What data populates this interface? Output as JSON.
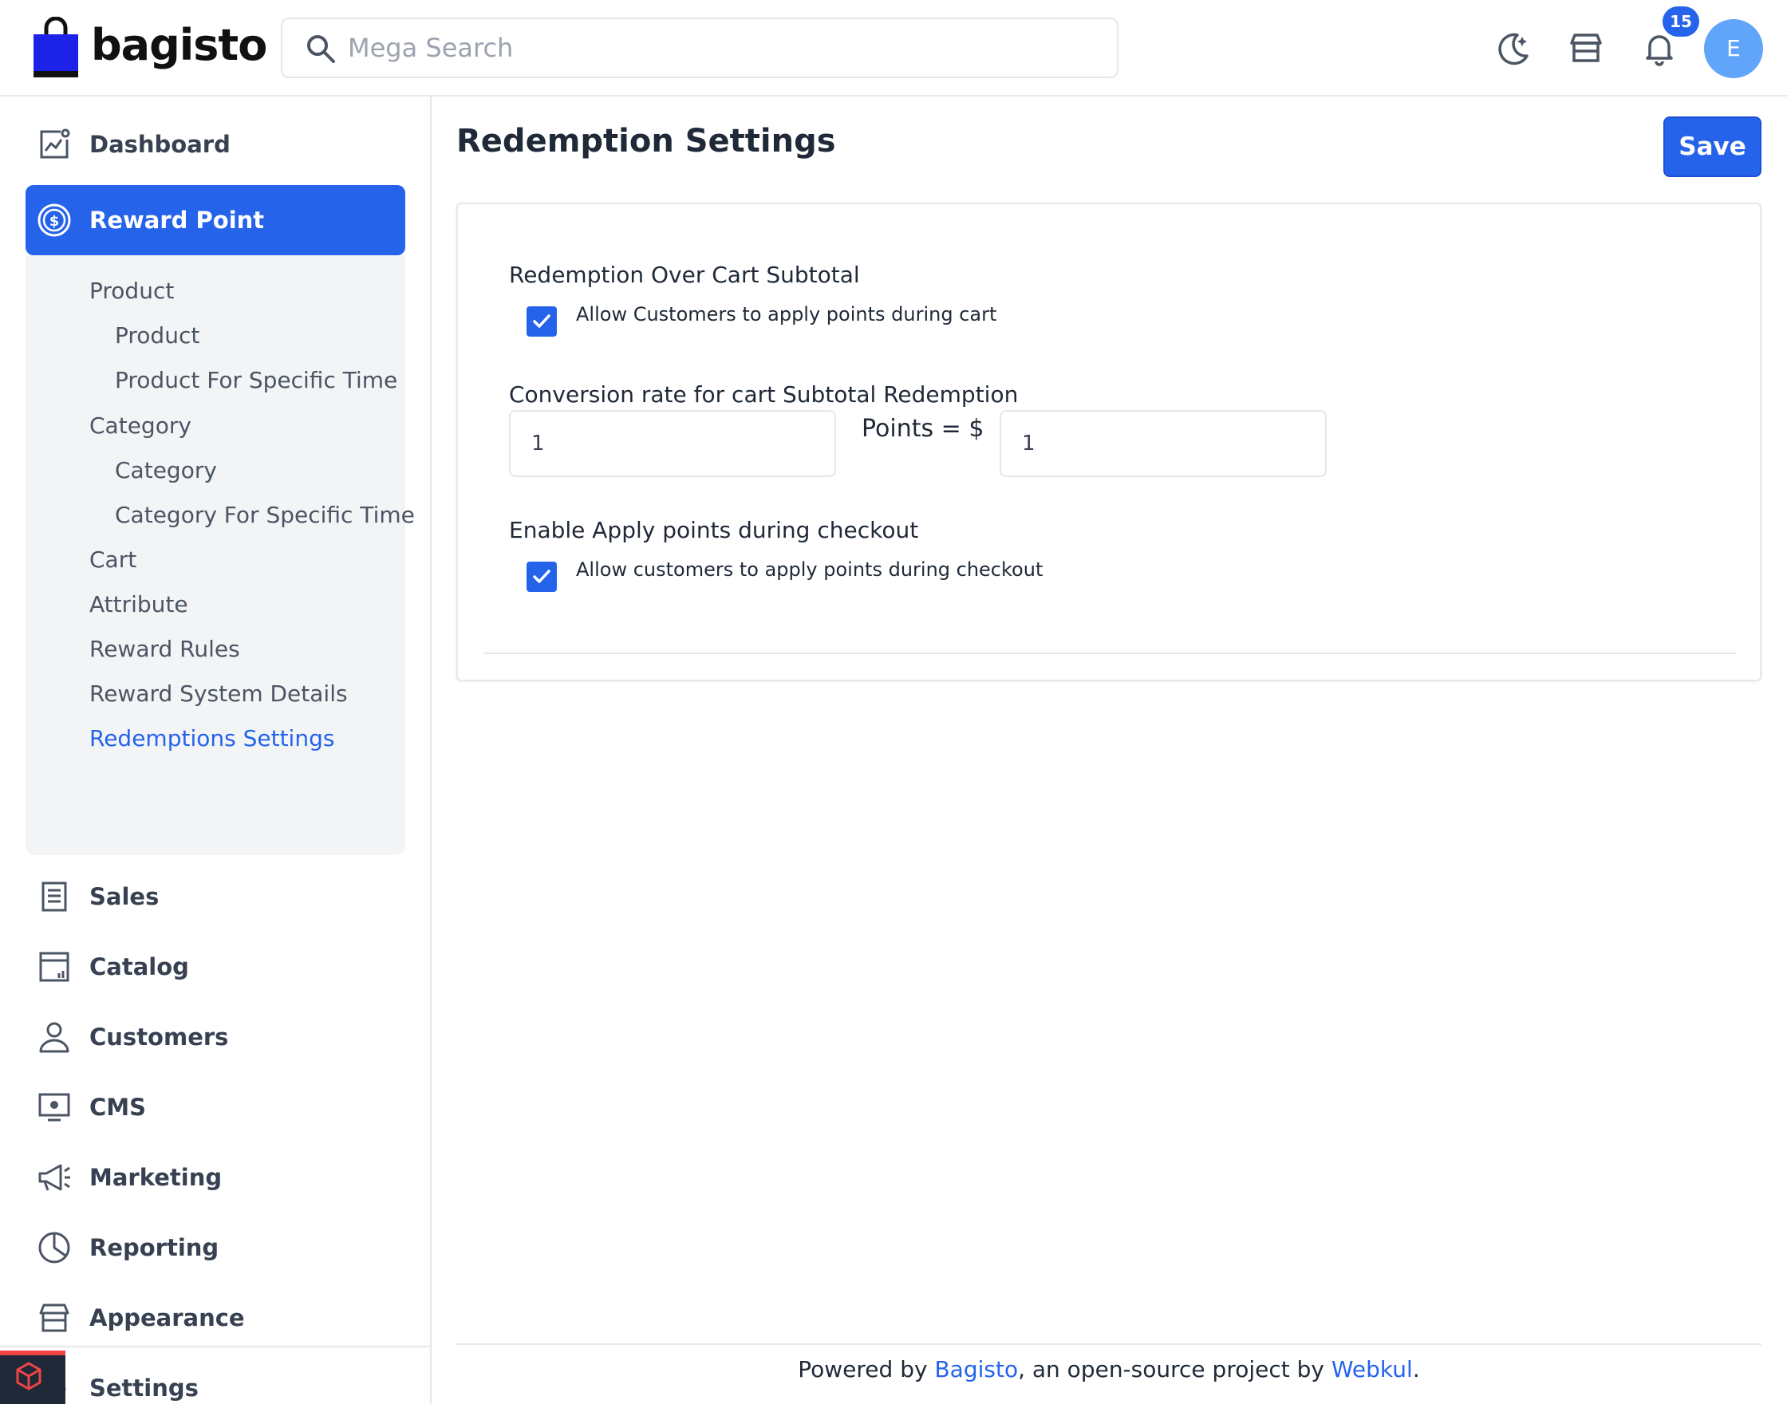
{
  "header": {
    "brand": "bagisto",
    "search_placeholder": "Mega Search",
    "notification_count": "15",
    "avatar_initial": "E",
    "accent_color": "#2563eb"
  },
  "sidebar": {
    "items": [
      {
        "label": "Dashboard",
        "icon": "dashboard-icon"
      },
      {
        "label": "Reward Point",
        "icon": "reward-point-icon",
        "active": true
      },
      {
        "label": "Sales",
        "icon": "sales-icon"
      },
      {
        "label": "Catalog",
        "icon": "catalog-icon"
      },
      {
        "label": "Customers",
        "icon": "customers-icon"
      },
      {
        "label": "CMS",
        "icon": "cms-icon"
      },
      {
        "label": "Marketing",
        "icon": "marketing-icon"
      },
      {
        "label": "Reporting",
        "icon": "reporting-icon"
      },
      {
        "label": "Appearance",
        "icon": "appearance-icon"
      },
      {
        "label": "Settings",
        "icon": "settings-icon"
      }
    ],
    "submenu": [
      {
        "label": "Product",
        "level": 1
      },
      {
        "label": "Product",
        "level": 2
      },
      {
        "label": "Product For Specific Time",
        "level": 2
      },
      {
        "label": "Category",
        "level": 1
      },
      {
        "label": "Category",
        "level": 2
      },
      {
        "label": "Category For Specific Time",
        "level": 2
      },
      {
        "label": "Cart",
        "level": 1
      },
      {
        "label": "Attribute",
        "level": 1
      },
      {
        "label": "Reward Rules",
        "level": 1
      },
      {
        "label": "Reward System Details",
        "level": 1
      },
      {
        "label": "Redemptions Settings",
        "level": 1,
        "active": true
      }
    ]
  },
  "main": {
    "title": "Redemption Settings",
    "save_label": "Save",
    "redemption_over_cart": {
      "label": "Redemption Over Cart Subtotal",
      "checkbox_text": "Allow Customers to apply points during cart",
      "checked": true
    },
    "conversion": {
      "label": "Conversion rate for cart Subtotal Redemption",
      "points_value": "1",
      "separator": "Points = $",
      "amount_value": "1"
    },
    "checkout": {
      "label": "Enable Apply points during checkout",
      "checkbox_text": "Allow customers to apply points during checkout",
      "checked": true
    }
  },
  "footer": {
    "prefix": "Powered by ",
    "link1": "Bagisto",
    "middle": ", an open-source project by ",
    "link2": "Webkul",
    "suffix": "."
  }
}
